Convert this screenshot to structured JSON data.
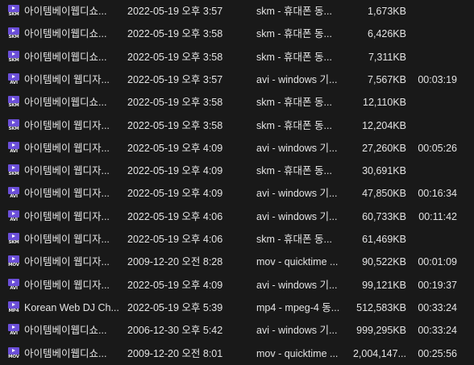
{
  "files": [
    {
      "name": "아이템베이웹디쇼...",
      "modified": "2022-05-19 오후 3:57",
      "type": "skm - 휴대폰 동...",
      "size": "1,673KB",
      "length": "",
      "icon": "skm-video-file-icon",
      "ext": "SKM"
    },
    {
      "name": "아이템베이웹디쇼...",
      "modified": "2022-05-19 오후 3:58",
      "type": "skm - 휴대폰 동...",
      "size": "6,426KB",
      "length": "",
      "icon": "skm-video-file-icon",
      "ext": "SKM"
    },
    {
      "name": "아이템베이웹디쇼...",
      "modified": "2022-05-19 오후 3:58",
      "type": "skm - 휴대폰 동...",
      "size": "7,311KB",
      "length": "",
      "icon": "skm-video-file-icon",
      "ext": "SKM"
    },
    {
      "name": "아이템베이 웹디자...",
      "modified": "2022-05-19 오후 3:57",
      "type": "avi - windows 기...",
      "size": "7,567KB",
      "length": "00:03:19",
      "icon": "avi-video-file-icon",
      "ext": "AVI"
    },
    {
      "name": "아이템베이웹디쇼...",
      "modified": "2022-05-19 오후 3:58",
      "type": "skm - 휴대폰 동...",
      "size": "12,110KB",
      "length": "",
      "icon": "skm-video-file-icon",
      "ext": "SKM"
    },
    {
      "name": "아이템베이 웹디자...",
      "modified": "2022-05-19 오후 3:58",
      "type": "skm - 휴대폰 동...",
      "size": "12,204KB",
      "length": "",
      "icon": "skm-video-file-icon",
      "ext": "SKM"
    },
    {
      "name": "아이템베이 웹디자...",
      "modified": "2022-05-19 오후 4:09",
      "type": "avi - windows 기...",
      "size": "27,260KB",
      "length": "00:05:26",
      "icon": "avi-video-file-icon",
      "ext": "AVI"
    },
    {
      "name": "아이템베이 웹디자...",
      "modified": "2022-05-19 오후 4:09",
      "type": "skm - 휴대폰 동...",
      "size": "30,691KB",
      "length": "",
      "icon": "skm-video-file-icon",
      "ext": "SKM"
    },
    {
      "name": "아이템베이 웹디자...",
      "modified": "2022-05-19 오후 4:09",
      "type": "avi - windows 기...",
      "size": "47,850KB",
      "length": "00:16:34",
      "icon": "avi-video-file-icon",
      "ext": "AVI"
    },
    {
      "name": "아이템베이 웹디자...",
      "modified": "2022-05-19 오후 4:06",
      "type": "avi - windows 기...",
      "size": "60,733KB",
      "length": "00:11:42",
      "icon": "avi-video-file-icon",
      "ext": "AVI"
    },
    {
      "name": "아이템베이 웹디자...",
      "modified": "2022-05-19 오후 4:06",
      "type": "skm - 휴대폰 동...",
      "size": "61,469KB",
      "length": "",
      "icon": "skm-video-file-icon",
      "ext": "SKM"
    },
    {
      "name": "아이템베이 웹디자...",
      "modified": "2009-12-20 오전 8:28",
      "type": "mov - quicktime ...",
      "size": "90,522KB",
      "length": "00:01:09",
      "icon": "mov-video-file-icon",
      "ext": "MOV"
    },
    {
      "name": "아이템베이 웹디자...",
      "modified": "2022-05-19 오후 4:09",
      "type": "avi - windows 기...",
      "size": "99,121KB",
      "length": "00:19:37",
      "icon": "avi-video-file-icon",
      "ext": "AVI"
    },
    {
      "name": "Korean Web DJ Ch...",
      "modified": "2022-05-19 오후 5:39",
      "type": "mp4 - mpeg-4 동...",
      "size": "512,583KB",
      "length": "00:33:24",
      "icon": "mp4-video-file-icon",
      "ext": "MP4"
    },
    {
      "name": "아이템베이웹디쇼...",
      "modified": "2006-12-30 오후 5:42",
      "type": "avi - windows 기...",
      "size": "999,295KB",
      "length": "00:33:24",
      "icon": "avi-video-file-icon",
      "ext": "AVI"
    },
    {
      "name": "아이템베이웹디쇼...",
      "modified": "2009-12-20 오전 8:01",
      "type": "mov - quicktime ...",
      "size": "2,004,147...",
      "length": "00:25:56",
      "icon": "mov-video-file-icon",
      "ext": "MOV"
    }
  ],
  "colors": {
    "background": "#191919",
    "text": "#e4e4e4",
    "icon_accent": "#6b4fd8"
  }
}
